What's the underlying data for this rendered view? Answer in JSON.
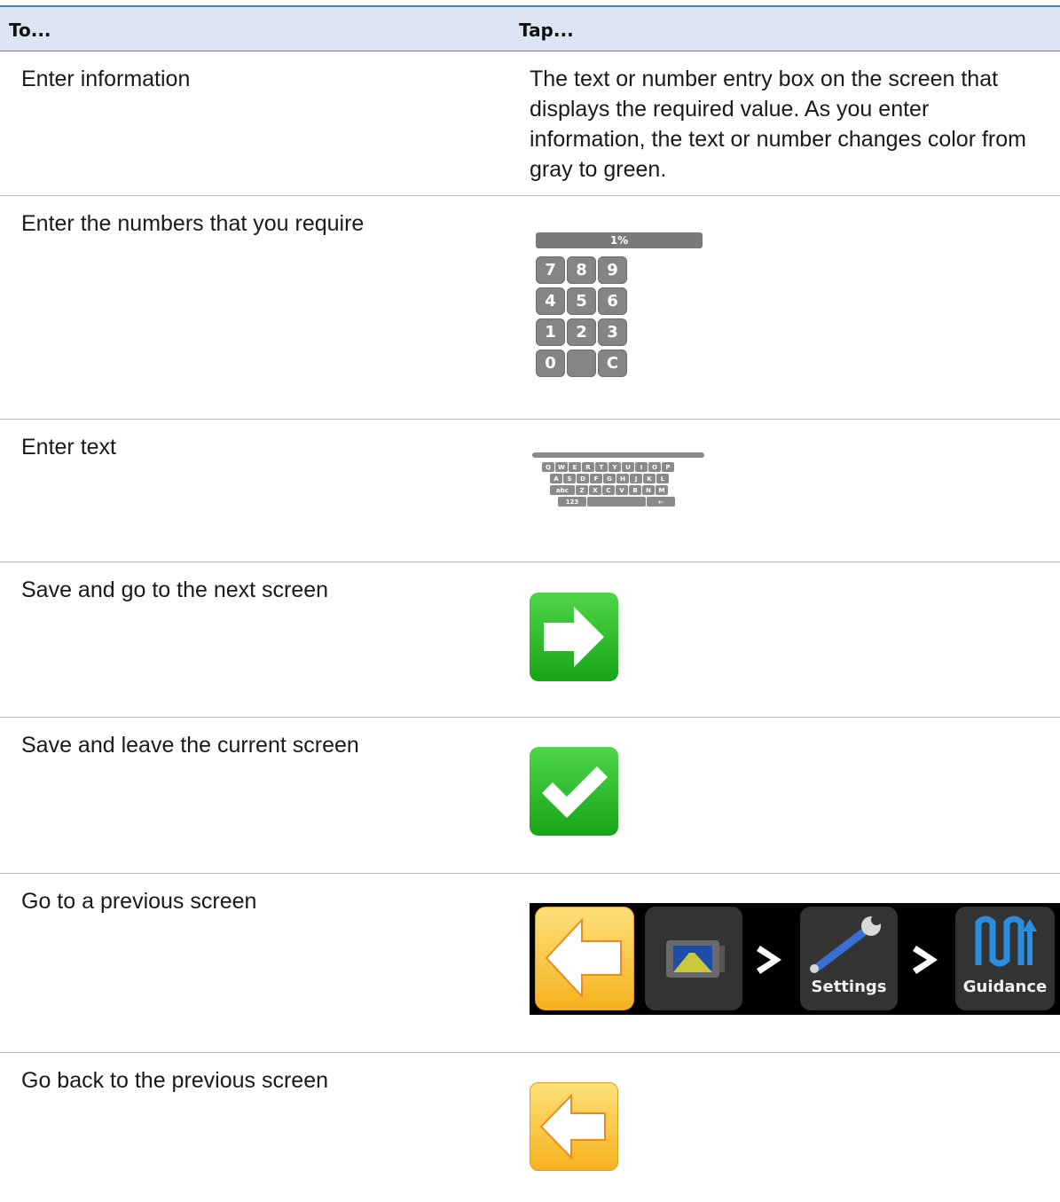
{
  "header": {
    "col_to": "To...",
    "col_tap": "Tap..."
  },
  "rows": [
    {
      "label": "Enter information",
      "text": "The text or number entry box on the screen that displays the required value. As you enter information, the text or number changes color from gray to green."
    },
    {
      "label": "Enter the numbers that you require"
    },
    {
      "label": "Enter text"
    },
    {
      "label": "Save and go to the next screen",
      "icon": "green-right-arrow-icon"
    },
    {
      "label": "Save and leave the current screen",
      "icon": "green-checkmark-icon"
    },
    {
      "label": "Go to a previous screen"
    },
    {
      "label": "Go back to the previous screen",
      "icon": "yellow-left-arrow-icon"
    }
  ],
  "keypad": {
    "display": "1%",
    "keys": [
      "7",
      "8",
      "9",
      "4",
      "5",
      "6",
      "1",
      "2",
      "3",
      "0",
      "",
      "C"
    ]
  },
  "keyboard": {
    "row1": [
      "Q",
      "W",
      "E",
      "R",
      "T",
      "Y",
      "U",
      "I",
      "O",
      "P"
    ],
    "row2": [
      "A",
      "S",
      "D",
      "F",
      "G",
      "H",
      "J",
      "K",
      "L"
    ],
    "row3": [
      "abc",
      "Z",
      "X",
      "C",
      "V",
      "B",
      "N",
      "M"
    ],
    "row4": [
      "123",
      "",
      "←"
    ]
  },
  "breadcrumb": {
    "items": [
      {
        "icon": "back-arrow-icon"
      },
      {
        "icon": "display-device-icon"
      },
      {
        "icon": "wrench-icon",
        "label": "Settings"
      },
      {
        "icon": "guidance-pattern-icon",
        "label": "Guidance"
      }
    ]
  },
  "colors": {
    "header_bg": "#dbe5f3",
    "header_rule": "#4f81bd",
    "green": "#22b422",
    "yellow": "#f8c23a",
    "key_gray": "#858585"
  }
}
